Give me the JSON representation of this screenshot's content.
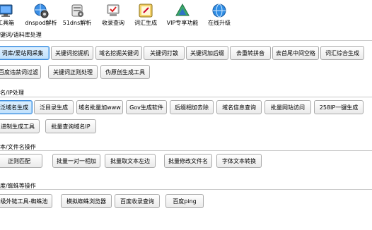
{
  "toolbar": {
    "items": [
      {
        "label": "工具箱",
        "icon": "monitor-icon"
      },
      {
        "label": "dnspod解析",
        "icon": "globe-gear-icon"
      },
      {
        "label": "51dns解析",
        "icon": "server-icon"
      },
      {
        "label": "收录查询",
        "icon": "computer-check-icon"
      },
      {
        "label": "词汇生成",
        "icon": "notepad-icon"
      },
      {
        "label": "VIP专享功能",
        "icon": "vip-icon"
      },
      {
        "label": "在线升级",
        "icon": "ie-globe-icon"
      }
    ]
  },
  "sections": {
    "keywords": {
      "title": "键词/语料库处理",
      "buttons": [
        "词库/爱站网采集",
        "关键词挖掘机",
        "域名挖掘关键词",
        "关键词打散",
        "关键词加后缀",
        "去重转拼音",
        "去首尾中间空格",
        "词汇综合生成",
        "百度违禁词过滤",
        "关键词正则处理",
        "伪原创生成工具"
      ]
    },
    "domains": {
      "title": "名/IP处理",
      "buttons": [
        "泛域名生成",
        "泛目录生成",
        "域名批量加www",
        "Gov生成软件",
        "后缀相加去除",
        "域名信息查询",
        "批量网站访问",
        "258IP一键生成",
        "进制生成工具",
        "批量查询域名IP"
      ]
    },
    "text": {
      "title": "本/文件名操作",
      "buttons": [
        "正则匹配",
        "批量一对一相加",
        "批量取文本左边",
        "批量修改文件名",
        "字体文本转换"
      ]
    },
    "spider": {
      "title": "度/蜘蛛等操作",
      "buttons": [
        "级外链工具-蜘蛛池",
        "模拟蜘蛛浏览器",
        "百度收录查询",
        "百度ping"
      ]
    }
  },
  "colors": {
    "accent": "#3c8de0",
    "button_border": "#a9a9a9",
    "divider": "#c8c8c8"
  }
}
